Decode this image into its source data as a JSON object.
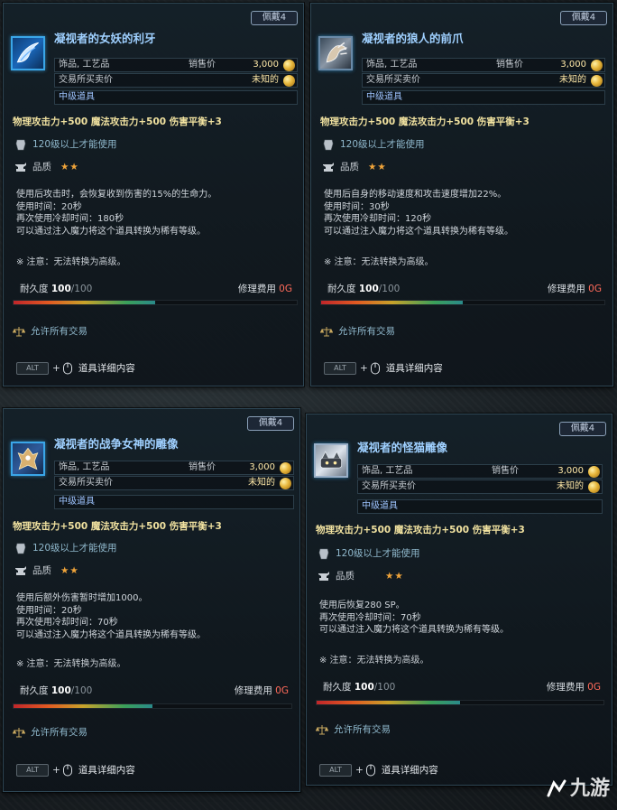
{
  "cards": [
    {
      "tag": "佩戴4",
      "title": "凝视者的女妖的利牙",
      "icon": "banshee-fang-icon",
      "type_label": "饰品, 工艺品",
      "sell_label": "销售价",
      "sell_price": "3,000",
      "trade_label": "交易所买卖价",
      "trade_price": "未知的",
      "grade": "中级道具",
      "stats": "物理攻击力+500  魔法攻击力+500  伤害平衡+3",
      "level_req": "120级以上才能使用",
      "quality_label": "品质",
      "quality_stars": "★★",
      "quality_level": 2,
      "desc": [
        "使用后攻击时，会恢复收到伤害的15%的生命力。",
        "使用时间：20秒",
        "再次使用冷却时间：180秒",
        "可以通过注入魔力将这个道具转换为稀有等级。"
      ],
      "note": "※ 注意：无法转换为高级。",
      "durability_label": "耐久度",
      "durability": "100",
      "durability_max": "/100",
      "durability_ratio": 0.5,
      "repair_label": "修理费用",
      "repair_cost": "0G",
      "tradeable": "允许所有交易",
      "alt_key": "ALT",
      "alt_text": "道具详细内容"
    },
    {
      "tag": "佩戴4",
      "title": "凝视者的狼人的前爪",
      "icon": "werewolf-claw-icon",
      "type_label": "饰品, 工艺品",
      "sell_label": "销售价",
      "sell_price": "3,000",
      "trade_label": "交易所买卖价",
      "trade_price": "未知的",
      "grade": "中级道具",
      "stats": "物理攻击力+500  魔法攻击力+500  伤害平衡+3",
      "level_req": "120级以上才能使用",
      "quality_label": "品质",
      "quality_stars": "★★",
      "quality_level": 2,
      "desc": [
        "使用后自身的移动速度和攻击速度增加22%。",
        "使用时间：30秒",
        "再次使用冷却时间：120秒",
        "可以通过注入魔力将这个道具转换为稀有等级。"
      ],
      "note": "※ 注意：无法转换为高级。",
      "durability_label": "耐久度",
      "durability": "100",
      "durability_max": "/100",
      "durability_ratio": 0.5,
      "repair_label": "修理费用",
      "repair_cost": "0G",
      "tradeable": "允许所有交易",
      "alt_key": "ALT",
      "alt_text": "道具详细内容"
    },
    {
      "tag": "佩戴4",
      "title": "凝视者的战争女神的雕像",
      "icon": "war-goddess-statue-icon",
      "type_label": "饰品, 工艺品",
      "sell_label": "销售价",
      "sell_price": "3,000",
      "trade_label": "交易所买卖价",
      "trade_price": "未知的",
      "grade": "中级道具",
      "stats": "物理攻击力+500  魔法攻击力+500  伤害平衡+3",
      "level_req": "120级以上才能使用",
      "quality_label": "品质",
      "quality_stars": "★★",
      "quality_level": 2,
      "desc": [
        "使用后额外伤害暂时增加1000。",
        "使用时间：20秒",
        "再次使用冷却时间：70秒",
        "可以通过注入魔力将这个道具转换为稀有等级。"
      ],
      "note": "※ 注意：无法转换为高级。",
      "durability_label": "耐久度",
      "durability": "100",
      "durability_max": "/100",
      "durability_ratio": 0.5,
      "repair_label": "修理费用",
      "repair_cost": "0G",
      "tradeable": "允许所有交易",
      "alt_key": "ALT",
      "alt_text": "道具详细内容"
    },
    {
      "tag": "佩戴4",
      "title": "凝视者的怪猫雕像",
      "icon": "monster-cat-statue-icon",
      "type_label": "饰品, 工艺品",
      "sell_label": "销售价",
      "sell_price": "3,000",
      "trade_label": "交易所买卖价",
      "trade_price": "未知的",
      "grade": "中级道具",
      "stats": "物理攻击力+500  魔法攻击力+500  伤害平衡+3",
      "level_req": "120级以上才能使用",
      "quality_label": "品质",
      "quality_stars": "★★",
      "quality_level": 2,
      "desc": [
        "使用后恢复280 SP。",
        "再次使用冷却时间：70秒",
        "可以通过注入魔力将这个道具转换为稀有等级。"
      ],
      "note": "※ 注意：无法转换为高级。",
      "durability_label": "耐久度",
      "durability": "100",
      "durability_max": "/100",
      "durability_ratio": 0.5,
      "repair_label": "修理费用",
      "repair_cost": "0G",
      "tradeable": "允许所有交易",
      "alt_key": "ALT",
      "alt_text": "道具详细内容"
    }
  ],
  "watermark": "九游",
  "colors": {
    "title": "#9fd0ff",
    "stats": "#f1e2a0",
    "stars": "#f0a43a",
    "repair_cost": "#ff6a5a",
    "icon_border": "#3aa6e8"
  }
}
